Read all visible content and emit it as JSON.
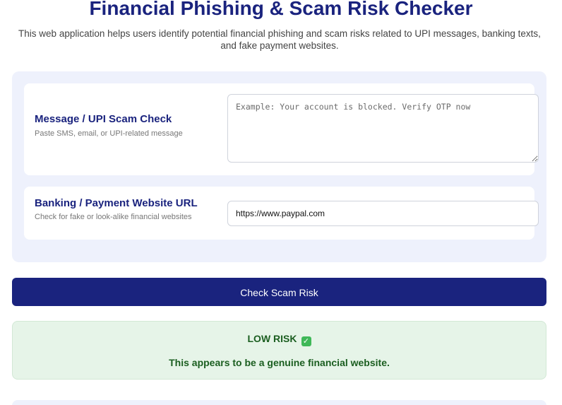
{
  "header": {
    "title": "Financial Phishing & Scam Risk Checker",
    "subtitle": "This web application helps users identify potential financial phishing and scam risks related to UPI messages, banking texts, and fake payment websites."
  },
  "message_check": {
    "title": "Message / UPI Scam Check",
    "description": "Paste SMS, email, or UPI-related message",
    "value": "",
    "placeholder": "Example: Your account is blocked. Verify OTP now"
  },
  "url_check": {
    "title": "Banking / Payment Website URL",
    "description": "Check for fake or look-alike financial websites",
    "value": "https://www.paypal.com"
  },
  "action": {
    "label": "Check Scam Risk"
  },
  "result": {
    "level": "LOW RISK",
    "icon": "check-mark-icon",
    "icon_glyph": "✓",
    "message": "This appears to be a genuine financial website."
  },
  "colors": {
    "accent": "#1a237e",
    "panel_background": "#eef1fc",
    "result_background": "#e6f4e8",
    "result_text": "#1b5e20",
    "check_icon": "#3fb858"
  }
}
